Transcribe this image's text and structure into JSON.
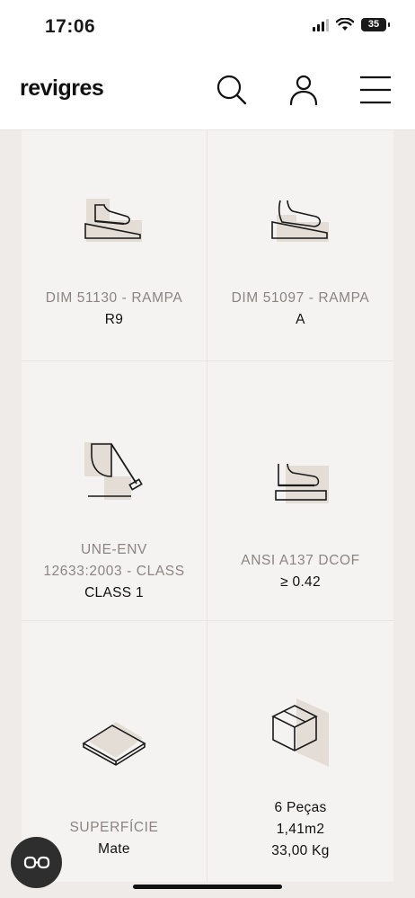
{
  "status": {
    "time": "17:06",
    "battery": "35"
  },
  "header": {
    "logo": "revigres",
    "icons": {
      "search": "search-icon",
      "account": "user-icon",
      "menu": "hamburger-menu-icon"
    }
  },
  "specs": [
    {
      "label": "DIM 51130 - RAMPA",
      "value": "R9",
      "icon": "shoe-ramp-icon"
    },
    {
      "label": "DIM 51097 - RAMPA",
      "value": "A",
      "icon": "barefoot-ramp-icon"
    },
    {
      "label_lines": [
        "UNE-ENV",
        "12633:2003 - CLASS"
      ],
      "value": "CLASS 1",
      "icon": "pendulum-icon"
    },
    {
      "label": "ANSI A137 DCOF",
      "value": "≥ 0.42",
      "icon": "shoe-flat-icon"
    },
    {
      "label": "SUPERFÍCIE",
      "value": "Mate",
      "icon": "tile-surface-icon"
    },
    {
      "value_lines": [
        "6 Peças",
        "1,41m2",
        "33,00 Kg"
      ],
      "icon": "box-icon"
    }
  ],
  "colors": {
    "accent_shape": "#e4ddd6",
    "panel": "#f5f3f2",
    "background": "#efebe9"
  },
  "fab": {
    "icon": "glasses-icon"
  }
}
